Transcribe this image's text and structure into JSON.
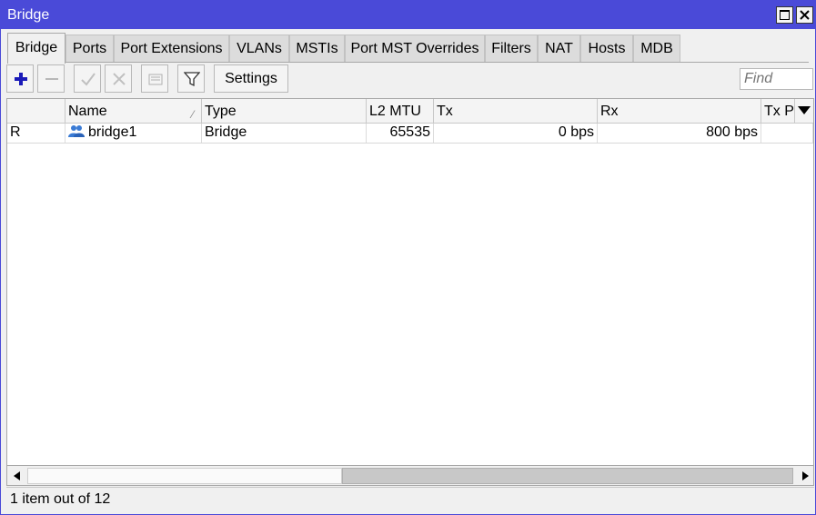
{
  "window": {
    "title": "Bridge"
  },
  "tabs": [
    {
      "label": "Bridge",
      "active": true
    },
    {
      "label": "Ports"
    },
    {
      "label": "Port Extensions"
    },
    {
      "label": "VLANs"
    },
    {
      "label": "MSTIs"
    },
    {
      "label": "Port MST Overrides"
    },
    {
      "label": "Filters"
    },
    {
      "label": "NAT"
    },
    {
      "label": "Hosts"
    },
    {
      "label": "MDB"
    }
  ],
  "toolbar": {
    "settings_label": "Settings",
    "find_placeholder": "Find",
    "icons": [
      "plus-icon",
      "minus-icon",
      "check-icon",
      "x-icon",
      "comment-icon",
      "filter-icon"
    ]
  },
  "table": {
    "columns": [
      "",
      "Name",
      "Type",
      "L2 MTU",
      "Tx",
      "Rx",
      "Tx Pa"
    ],
    "rows": [
      {
        "flag": "R",
        "name": "bridge1",
        "type": "Bridge",
        "l2mtu": "65535",
        "tx": "0 bps",
        "rx": "800 bps",
        "txp": ""
      }
    ]
  },
  "status": {
    "text": "1 item out of 12"
  },
  "colors": {
    "titlebar": "#4a4ad8",
    "plus": "#1a1ab8"
  }
}
